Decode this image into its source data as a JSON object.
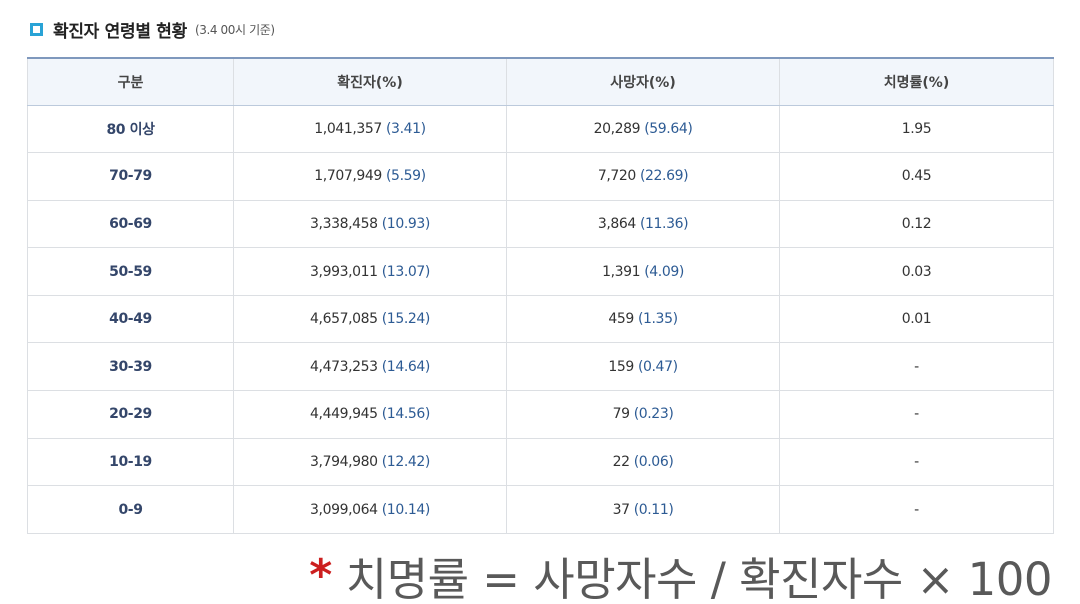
{
  "header": {
    "title": "확진자 연령별 현황",
    "note": "(3.4 00시 기준)"
  },
  "table": {
    "columns": [
      "구분",
      "확진자(%)",
      "사망자(%)",
      "치명률(%)"
    ],
    "rows": [
      {
        "age": "80 이상",
        "cases": "1,041,357",
        "cases_pct": "(3.41)",
        "deaths": "20,289",
        "deaths_pct": "(59.64)",
        "cfr": "1.95"
      },
      {
        "age": "70-79",
        "cases": "1,707,949",
        "cases_pct": "(5.59)",
        "deaths": "7,720",
        "deaths_pct": "(22.69)",
        "cfr": "0.45"
      },
      {
        "age": "60-69",
        "cases": "3,338,458",
        "cases_pct": "(10.93)",
        "deaths": "3,864",
        "deaths_pct": "(11.36)",
        "cfr": "0.12"
      },
      {
        "age": "50-59",
        "cases": "3,993,011",
        "cases_pct": "(13.07)",
        "deaths": "1,391",
        "deaths_pct": "(4.09)",
        "cfr": "0.03"
      },
      {
        "age": "40-49",
        "cases": "4,657,085",
        "cases_pct": "(15.24)",
        "deaths": "459",
        "deaths_pct": "(1.35)",
        "cfr": "0.01"
      },
      {
        "age": "30-39",
        "cases": "4,473,253",
        "cases_pct": "(14.64)",
        "deaths": "159",
        "deaths_pct": "(0.47)",
        "cfr": "-"
      },
      {
        "age": "20-29",
        "cases": "4,449,945",
        "cases_pct": "(14.56)",
        "deaths": "79",
        "deaths_pct": "(0.23)",
        "cfr": "-"
      },
      {
        "age": "10-19",
        "cases": "3,794,980",
        "cases_pct": "(12.42)",
        "deaths": "22",
        "deaths_pct": "(0.06)",
        "cfr": "-"
      },
      {
        "age": "0-9",
        "cases": "3,099,064",
        "cases_pct": "(10.14)",
        "deaths": "37",
        "deaths_pct": "(0.11)",
        "cfr": "-"
      }
    ]
  },
  "formula": {
    "asterisk": "*",
    "text": "치명률 = 사망자수 / 확진자수 × 100"
  },
  "colors": {
    "accent_icon": "#29a3d6",
    "header_bg": "#f2f6fb",
    "header_top_border": "#7f98bd",
    "value_blue": "#2d5b94",
    "age_label": "#34466a",
    "asterisk_red": "#cc1f1f"
  }
}
